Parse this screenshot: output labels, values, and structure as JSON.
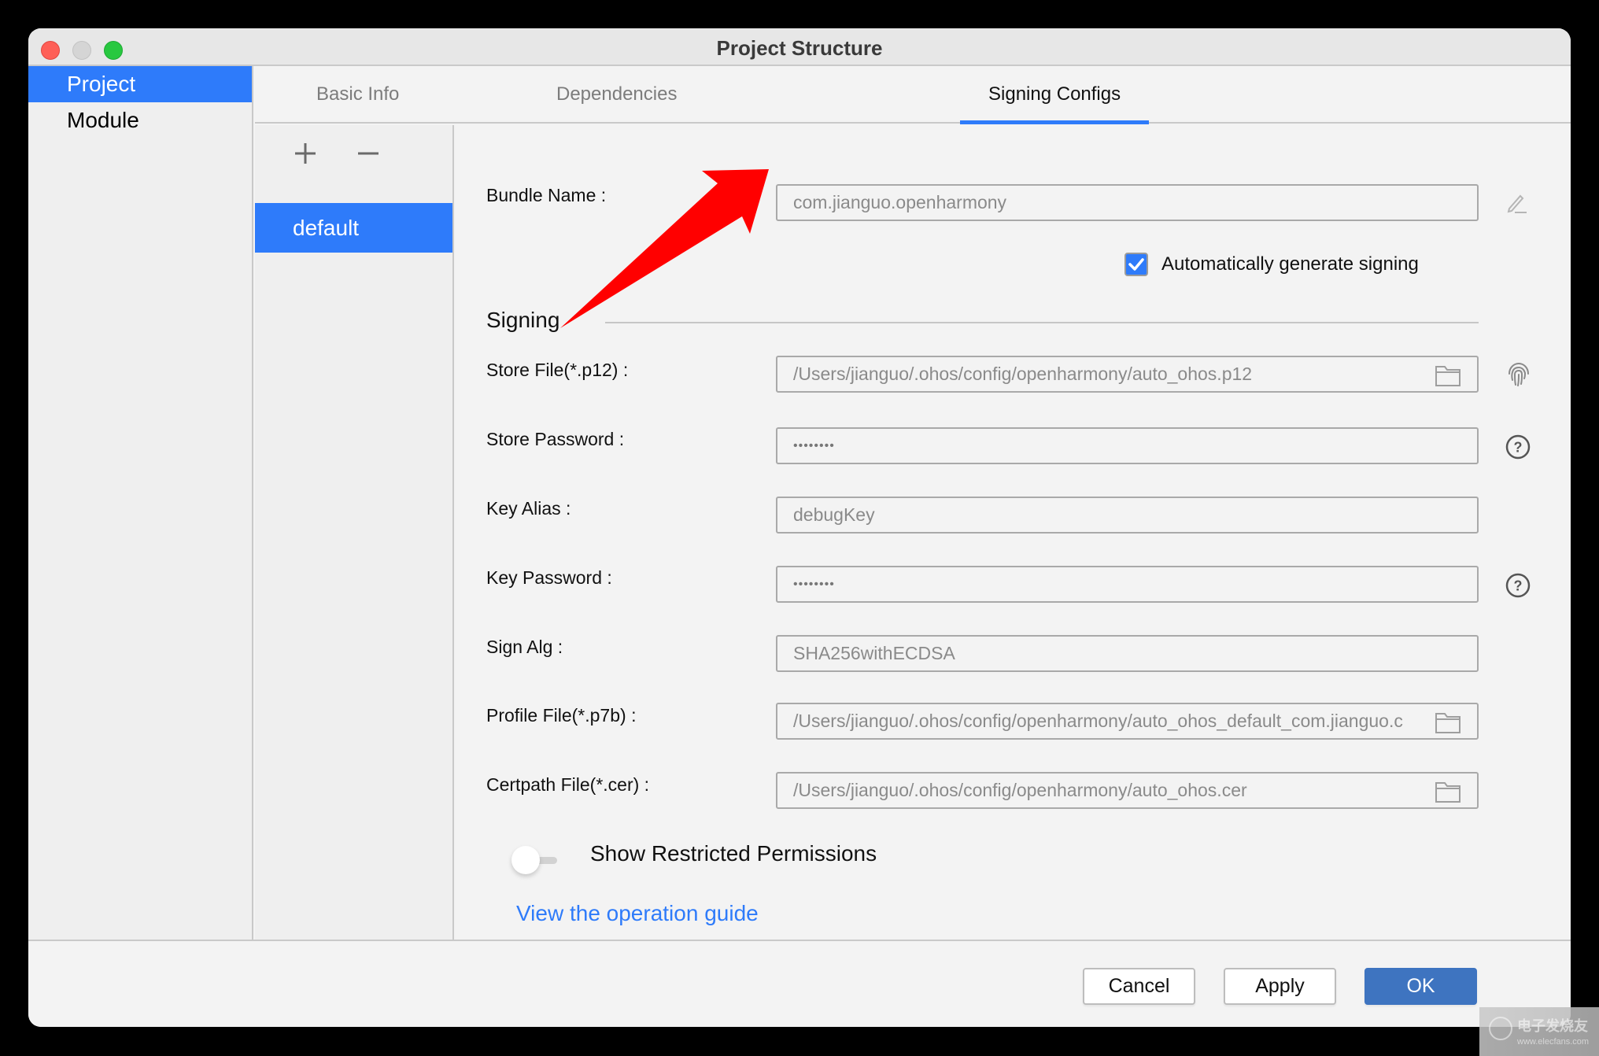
{
  "window": {
    "title": "Project Structure",
    "controls": [
      "close",
      "minimize",
      "maximize"
    ]
  },
  "sidebar": {
    "items": [
      {
        "label": "Project",
        "active": true
      },
      {
        "label": "Module",
        "active": false
      }
    ]
  },
  "tabs": [
    {
      "label": "Basic Info",
      "active": false
    },
    {
      "label": "Dependencies",
      "active": false
    },
    {
      "label": "Signing Configs",
      "active": true
    }
  ],
  "configs": {
    "add_icon": "plus-icon",
    "remove_icon": "minus-icon",
    "items": [
      {
        "label": "default",
        "selected": true
      }
    ]
  },
  "form": {
    "bundle_name": {
      "label": "Bundle Name :",
      "value": "com.jianguo.openharmony",
      "icon": "pencil-icon"
    },
    "auto_sign": {
      "label": "Automatically generate signing",
      "checked": true
    },
    "section_title": "Signing",
    "fields": [
      {
        "label": "Store File(*.p12) :",
        "value": "/Users/jianguo/.ohos/config/openharmony/auto_ohos.p12",
        "browse": true,
        "side_icon": "fingerprint-icon"
      },
      {
        "label": "Store Password :",
        "value": "••••••••",
        "password": true,
        "side_icon": "help-icon"
      },
      {
        "label": "Key Alias :",
        "value": "debugKey"
      },
      {
        "label": "Key Password :",
        "value": "••••••••",
        "password": true,
        "side_icon": "help-icon"
      },
      {
        "label": "Sign Alg :",
        "value": "SHA256withECDSA"
      },
      {
        "label": "Profile File(*.p7b) :",
        "value": "/Users/jianguo/.ohos/config/openharmony/auto_ohos_default_com.jianguo.c",
        "browse": true
      },
      {
        "label": "Certpath File(*.cer) :",
        "value": "/Users/jianguo/.ohos/config/openharmony/auto_ohos.cer",
        "browse": true
      }
    ],
    "restricted_toggle": {
      "label": "Show Restricted Permissions",
      "on": false
    },
    "guide_link": "View the operation guide"
  },
  "footer": {
    "cancel": "Cancel",
    "apply": "Apply",
    "ok": "OK"
  },
  "colors": {
    "accent": "#2e7bfa",
    "primary_button": "#3e74c0",
    "annotation_arrow": "#ff0000"
  },
  "watermark": {
    "text": "电子发烧友",
    "sub": "www.elecfans.com"
  }
}
